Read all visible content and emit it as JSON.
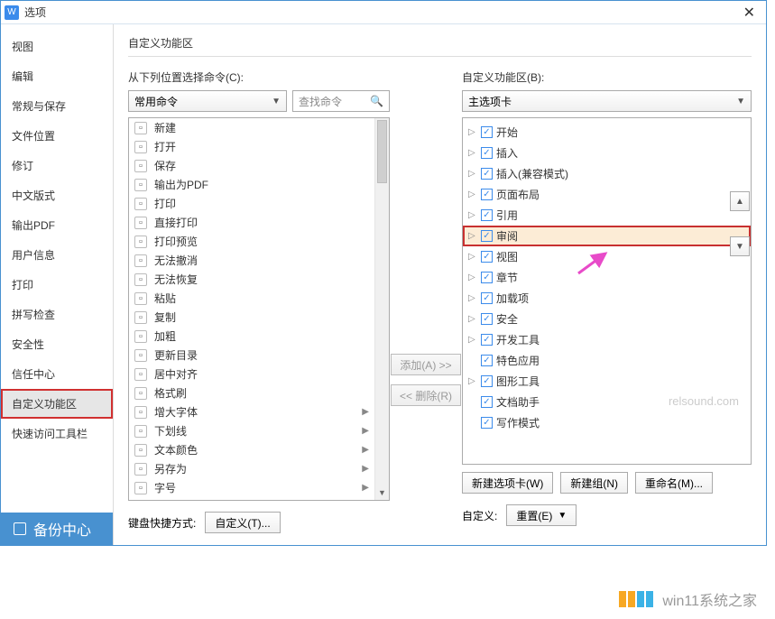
{
  "titlebar": {
    "title": "选项",
    "close": "✕",
    "app_glyph": "W"
  },
  "sidebar": {
    "items": [
      {
        "label": "视图"
      },
      {
        "label": "编辑"
      },
      {
        "label": "常规与保存"
      },
      {
        "label": "文件位置"
      },
      {
        "label": "修订"
      },
      {
        "label": "中文版式"
      },
      {
        "label": "输出PDF"
      },
      {
        "label": "用户信息"
      },
      {
        "label": "打印"
      },
      {
        "label": "拼写检查"
      },
      {
        "label": "安全性"
      },
      {
        "label": "信任中心"
      },
      {
        "label": "自定义功能区"
      },
      {
        "label": "快速访问工具栏"
      }
    ],
    "backup_label": "备份中心"
  },
  "main": {
    "heading": "自定义功能区",
    "left_label": "从下列位置选择命令(C):",
    "right_label": "自定义功能区(B):",
    "left_dropdown": "常用命令",
    "right_dropdown": "主选项卡",
    "search_placeholder": "查找命令",
    "add_btn": "添加(A) >>",
    "remove_btn": "<< 删除(R)",
    "new_tab_btn": "新建选项卡(W)",
    "new_group_btn": "新建组(N)",
    "rename_btn": "重命名(M)...",
    "shortcut_label": "键盘快捷方式:",
    "shortcut_btn": "自定义(T)...",
    "custom_label": "自定义:",
    "reset_btn": "重置(E)",
    "caret": "▼",
    "commands": [
      {
        "label": "新建",
        "arrow": false
      },
      {
        "label": "打开",
        "arrow": false
      },
      {
        "label": "保存",
        "arrow": false
      },
      {
        "label": "输出为PDF",
        "arrow": false
      },
      {
        "label": "打印",
        "arrow": false
      },
      {
        "label": "直接打印",
        "arrow": false
      },
      {
        "label": "打印预览",
        "arrow": false
      },
      {
        "label": "无法撤消",
        "arrow": false
      },
      {
        "label": "无法恢复",
        "arrow": false
      },
      {
        "label": "粘贴",
        "arrow": false
      },
      {
        "label": "复制",
        "arrow": false
      },
      {
        "label": "加粗",
        "arrow": false
      },
      {
        "label": "更新目录",
        "arrow": false
      },
      {
        "label": "居中对齐",
        "arrow": false
      },
      {
        "label": "格式刷",
        "arrow": false
      },
      {
        "label": "增大字体",
        "arrow": true
      },
      {
        "label": "下划线",
        "arrow": true
      },
      {
        "label": "文本颜色",
        "arrow": true
      },
      {
        "label": "另存为",
        "arrow": true
      },
      {
        "label": "字号",
        "arrow": true
      }
    ],
    "tree": [
      {
        "label": "开始",
        "tri": true
      },
      {
        "label": "插入",
        "tri": true
      },
      {
        "label": "插入(兼容模式)",
        "tri": true
      },
      {
        "label": "页面布局",
        "tri": true
      },
      {
        "label": "引用",
        "tri": true
      },
      {
        "label": "审阅",
        "tri": true,
        "hl": true
      },
      {
        "label": "视图",
        "tri": true
      },
      {
        "label": "章节",
        "tri": true
      },
      {
        "label": "加载项",
        "tri": true
      },
      {
        "label": "安全",
        "tri": true
      },
      {
        "label": "开发工具",
        "tri": true
      },
      {
        "label": "特色应用",
        "tri": false
      },
      {
        "label": "图形工具",
        "tri": true
      },
      {
        "label": "文档助手",
        "tri": false
      },
      {
        "label": "写作模式",
        "tri": false
      }
    ]
  },
  "watermark": "relsound.com",
  "footer": "win11系统之家"
}
